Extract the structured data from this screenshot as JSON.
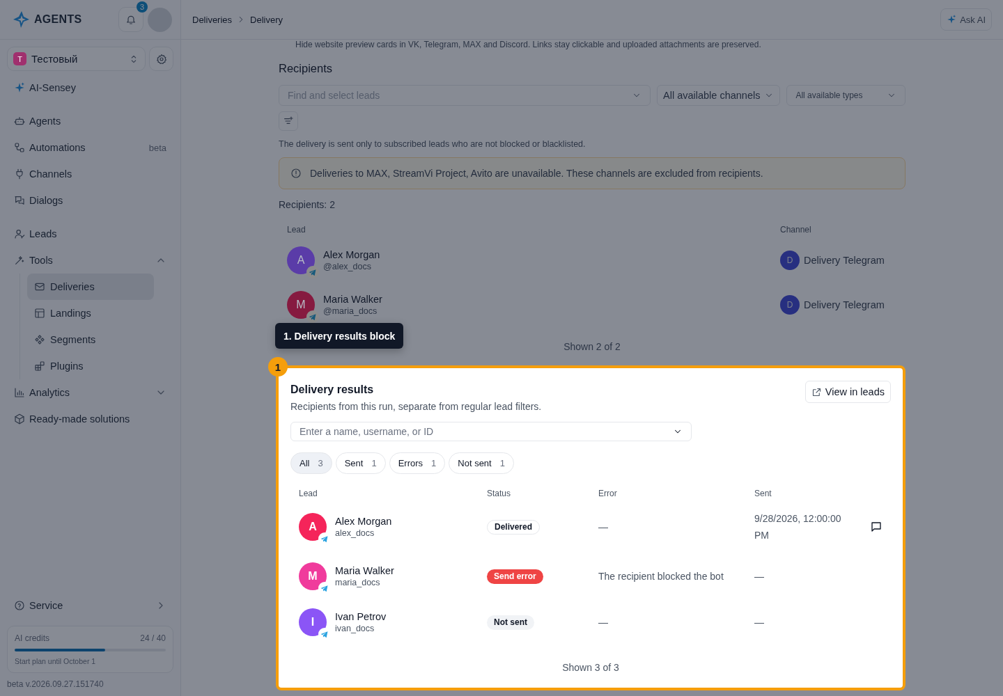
{
  "app": {
    "logo": "AGENTS",
    "notifications": "3"
  },
  "workspace": {
    "initial": "T",
    "name": "Тестовый",
    "color": "#a0306e"
  },
  "sidebar": {
    "groups": [
      {
        "items": [
          {
            "label": "AI-Sensey"
          }
        ]
      },
      {
        "items": [
          {
            "label": "Agents"
          },
          {
            "label": "Automations",
            "badge": "beta"
          },
          {
            "label": "Channels"
          },
          {
            "label": "Dialogs"
          }
        ]
      },
      {
        "items": [
          {
            "label": "Leads"
          },
          {
            "label": "Tools",
            "expanded": true,
            "children": [
              {
                "label": "Deliveries",
                "selected": true
              },
              {
                "label": "Landings",
                "selected": false
              },
              {
                "label": "Segments",
                "selected": false
              },
              {
                "label": "Plugins",
                "selected": false
              }
            ]
          },
          {
            "label": "Analytics",
            "expanded": false
          },
          {
            "label": "Ready-made solutions"
          }
        ]
      }
    ],
    "service": "Service",
    "credits": {
      "label": "AI credits",
      "reading": "24 / 40",
      "level": 0.6,
      "note": "Start plan until October 1"
    },
    "version": "beta v.2026.09.27.151740"
  },
  "header": {
    "breadcrumb": [
      "Deliveries",
      "Delivery"
    ],
    "ask_ai": "Ask AI"
  },
  "top_note": "Hide website preview cards in VK, Telegram, MAX and Discord. Links stay clickable and uploaded attachments are preserved.",
  "recipients": {
    "title": "Recipients",
    "lead_select": {
      "placeholder": "Find and select leads"
    },
    "channel_select": {
      "value": "All available channels"
    },
    "type_select": {
      "value": "All available types"
    },
    "note": "The delivery is sent only to subscribed leads who are not blocked or blacklisted.",
    "alert": "Deliveries to MAX, StreamVi Project, Avito are unavailable. These channels are excluded from recipients.",
    "count": "Recipients: 2",
    "columns": [
      "Lead",
      "Channel"
    ],
    "rows": [
      {
        "initial": "A",
        "color": "#5a3ca8",
        "name": "Alex Morgan",
        "username": "@alex_docs",
        "channel_initial": "D",
        "channel": "Delivery Telegram"
      },
      {
        "initial": "M",
        "color": "#861a40",
        "name": "Maria Walker",
        "username": "@maria_docs",
        "channel_initial": "D",
        "channel": "Delivery Telegram"
      }
    ],
    "footer": "Shown 2 of 2"
  },
  "tour": {
    "step": "1",
    "tooltip": "1. Delivery results block"
  },
  "results": {
    "title": "Delivery results",
    "subtitle": "Recipients from this run, separate from regular lead filters.",
    "view_button": "View in leads",
    "search": {
      "placeholder": "Enter a name, username, or ID"
    },
    "filters": [
      {
        "label": "All",
        "count": "3",
        "selected": true
      },
      {
        "label": "Sent",
        "count": "1",
        "selected": false
      },
      {
        "label": "Errors",
        "count": "1",
        "selected": false
      },
      {
        "label": "Not sent",
        "count": "1",
        "selected": false
      }
    ],
    "columns": [
      "Lead",
      "Status",
      "Error",
      "Sent"
    ],
    "rows": [
      {
        "initial": "A",
        "color": "#f5245a",
        "name": "Alex Morgan",
        "username": "alex_docs",
        "status": "Delivered",
        "kind": "delivered",
        "error": "—",
        "sent": "9/28/2026, 12:00:00 PM",
        "message_icon": true
      },
      {
        "initial": "M",
        "color": "#f03b9c",
        "name": "Maria Walker",
        "username": "maria_docs",
        "status": "Send error",
        "kind": "error",
        "error": "The recipient blocked the bot",
        "sent": "—",
        "message_icon": false
      },
      {
        "initial": "I",
        "color": "#8b55f6",
        "name": "Ivan Petrov",
        "username": "ivan_docs",
        "status": "Not sent",
        "kind": "not_sent",
        "error": "—",
        "sent": "—",
        "message_icon": false
      }
    ],
    "footer": "Shown 3 of 3"
  }
}
